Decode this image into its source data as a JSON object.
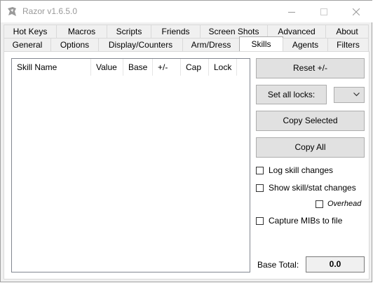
{
  "window": {
    "title": "Razor v1.6.5.0"
  },
  "tabs": {
    "row1": [
      "Hot Keys",
      "Macros",
      "Scripts",
      "Friends",
      "Screen Shots",
      "Advanced",
      "About"
    ],
    "row2": [
      "General",
      "Options",
      "Display/Counters",
      "Arm/Dress",
      "Skills",
      "Agents",
      "Filters"
    ],
    "active": "Skills"
  },
  "skills_list": {
    "columns": [
      "Skill Name",
      "Value",
      "Base",
      "+/-",
      "Cap",
      "Lock"
    ]
  },
  "buttons": {
    "reset": "Reset  +/-",
    "set_all_locks": "Set all locks:",
    "copy_selected": "Copy Selected",
    "copy_all": "Copy All"
  },
  "checkboxes": {
    "log_skill_changes": "Log skill changes",
    "show_skill_stat_changes": "Show skill/stat changes",
    "overhead": "Overhead",
    "capture_mibs": "Capture MIBs to file"
  },
  "base_total": {
    "label": "Base Total:",
    "value": "0.0"
  }
}
